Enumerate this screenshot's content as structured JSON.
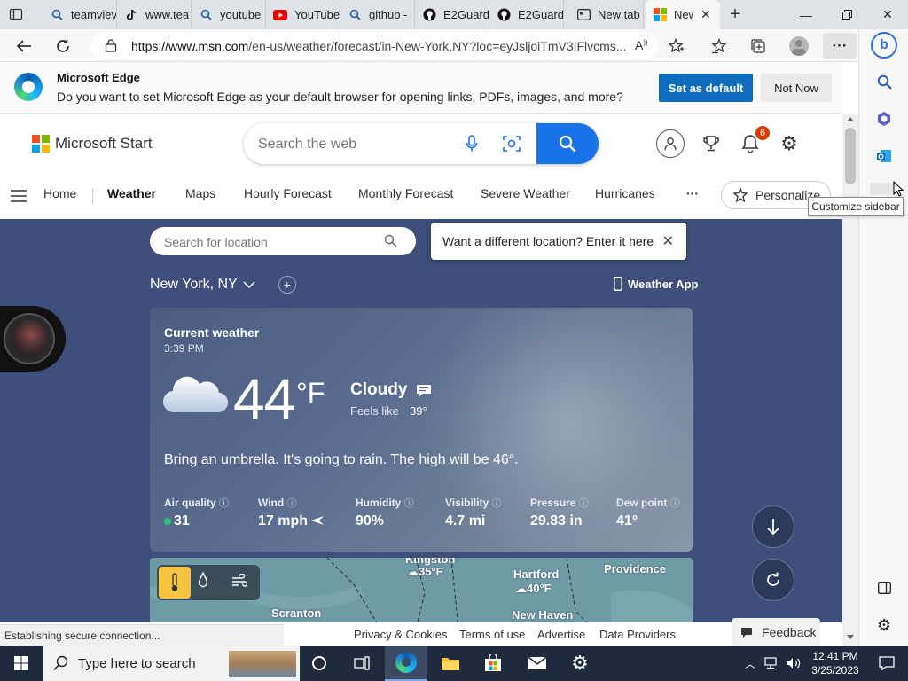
{
  "browser": {
    "tabs": [
      {
        "icon": "search-icon",
        "label": "teamviev"
      },
      {
        "icon": "tiktok-icon",
        "label": "www.tea"
      },
      {
        "icon": "search-icon",
        "label": "youtube"
      },
      {
        "icon": "youtube-icon",
        "label": "YouTube"
      },
      {
        "icon": "search-icon",
        "label": "github -"
      },
      {
        "icon": "github-icon",
        "label": "E2Guard"
      },
      {
        "icon": "github-icon",
        "label": "E2Guard"
      },
      {
        "icon": "newtab-icon",
        "label": "New tab"
      },
      {
        "icon": "msn-icon",
        "label": "New"
      }
    ],
    "url_host": "https://www.msn.com",
    "url_path": "/en-us/weather/forecast/in-New-York,NY?loc=eyJsljoiTmV3IFlvcms...",
    "colors": {
      "accent": "#0f6cbd",
      "weather_bg": "#3d4f7a"
    }
  },
  "banner": {
    "title": "Microsoft Edge",
    "message": "Do you want to set Microsoft Edge as your default browser for opening links, PDFs, images, and more?",
    "set_default": "Set as default",
    "not_now": "Not Now"
  },
  "msn": {
    "logo_text": "Microsoft Start",
    "search_placeholder": "Search the web",
    "notification_count": "6",
    "nav": [
      "Home",
      "Weather",
      "Maps",
      "Hourly Forecast",
      "Monthly Forecast",
      "Severe Weather",
      "Hurricanes"
    ],
    "more": "···",
    "personalize": "Personalize",
    "tooltip": "Customize sidebar"
  },
  "weather": {
    "location_placeholder": "Search for location",
    "popup_text": "Want a different location? Enter it here",
    "city": "New York, NY",
    "weather_app": "Weather App",
    "current_label": "Current weather",
    "time": "3:39 PM",
    "temp": "44",
    "unit": "°F",
    "condition": "Cloudy",
    "feels_label": "Feels like",
    "feels_value": "39°",
    "summary": "Bring an umbrella. It's going to rain. The high will be 46°.",
    "metrics": [
      {
        "label": "Air quality",
        "value": "31"
      },
      {
        "label": "Wind",
        "value": "17 mph"
      },
      {
        "label": "Humidity",
        "value": "90%"
      },
      {
        "label": "Visibility",
        "value": "4.7 mi"
      },
      {
        "label": "Pressure",
        "value": "29.83 in"
      },
      {
        "label": "Dew point",
        "value": "41°"
      }
    ],
    "map_labels": [
      {
        "name": "Kingston",
        "temp": "35°F"
      },
      {
        "name": "Hartford",
        "temp": "40°F"
      },
      {
        "name": "Providence",
        "temp": ""
      },
      {
        "name": "Scranton",
        "temp": ""
      },
      {
        "name": "New Haven",
        "temp": ""
      }
    ]
  },
  "status": "Establishing secure connection...",
  "footer": {
    "links": [
      "Privacy & Cookies",
      "Terms of use",
      "Advertise",
      "Data Providers"
    ],
    "feedback": "Feedback"
  },
  "taskbar": {
    "search_placeholder": "Type here to search",
    "time": "12:41 PM",
    "date": "3/25/2023"
  }
}
